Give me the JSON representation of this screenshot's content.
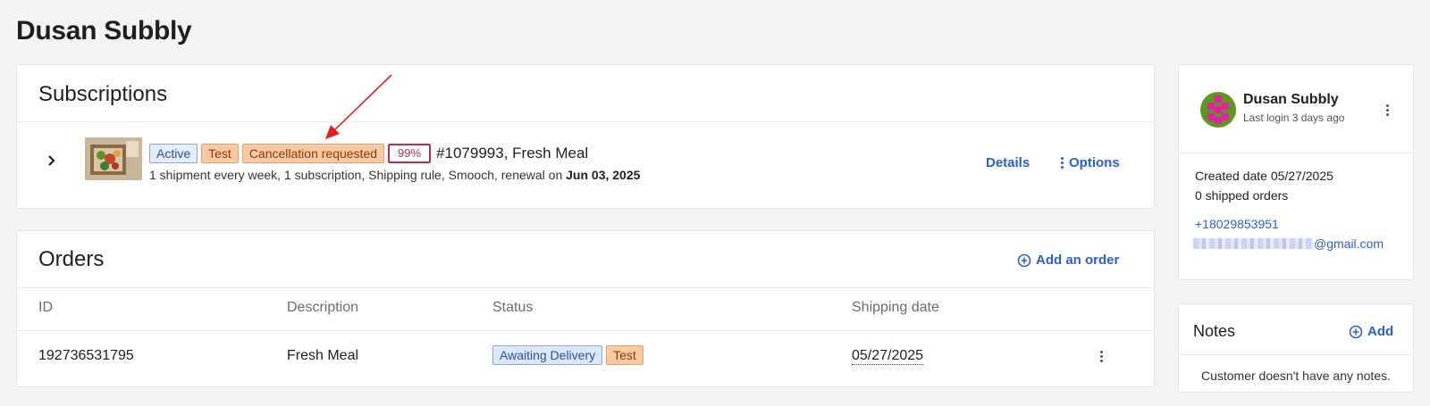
{
  "page": {
    "title": "Dusan Subbly"
  },
  "subscriptions": {
    "title": "Subscriptions",
    "item": {
      "badges": [
        "Active",
        "Test",
        "Cancellation requested",
        "99%"
      ],
      "name": "#1079993, Fresh Meal",
      "summary": "1 shipment every week, 1 subscription, Shipping rule, Smooch, renewal on",
      "renewal_date": "Jun 03, 2025",
      "details_label": "Details",
      "options_label": "Options"
    }
  },
  "orders": {
    "title": "Orders",
    "add_label": "Add an order",
    "columns": [
      "ID",
      "Description",
      "Status",
      "Shipping date"
    ],
    "rows": [
      {
        "id": "192736531795",
        "description": "Fresh Meal",
        "status": [
          "Awaiting Delivery",
          "Test"
        ],
        "shipping_date": "05/27/2025"
      }
    ]
  },
  "customer": {
    "name": "Dusan Subbly",
    "last_login": "Last login 3 days ago",
    "created": "Created date 05/27/2025",
    "shipped": "0 shipped orders",
    "phone": "+18029853951",
    "email_suffix": "@gmail.com"
  },
  "notes": {
    "title": "Notes",
    "add_label": "Add",
    "empty_text": "Customer doesn't have any notes."
  },
  "colors": {
    "accent": "#2b5ed8",
    "test_badge": "#fbc9a2",
    "active_badge": "#e4ecfb",
    "pct_border": "#c62a4b"
  },
  "icons": [
    "chevron-right-icon",
    "vertical-dots-icon",
    "plus-circle-icon"
  ]
}
